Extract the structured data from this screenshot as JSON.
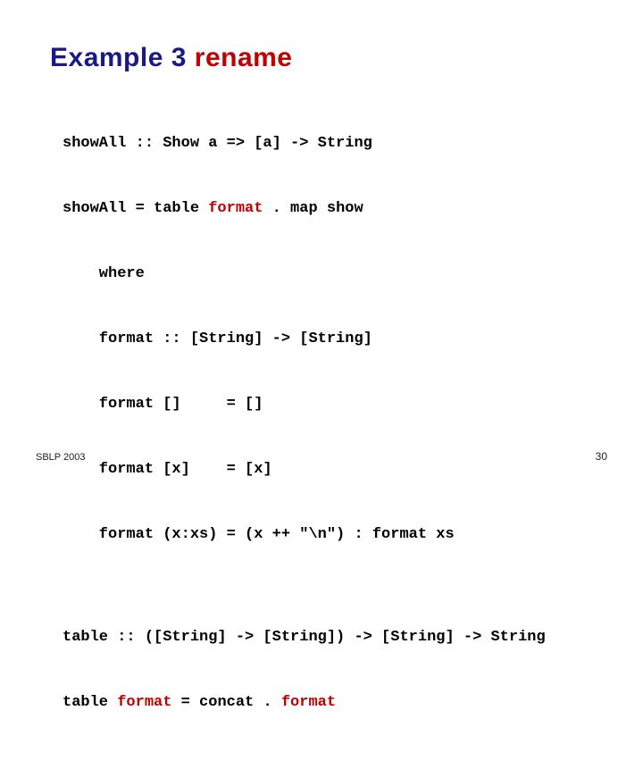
{
  "title": {
    "prefix": "Example 3 ",
    "rename": "rename"
  },
  "code": {
    "l1": "showAll :: Show a => [a] -> String",
    "l2_a": "showAll = table ",
    "l2_b": "format",
    "l2_c": " . map show",
    "l3": "    where",
    "l4": "    format :: [String] -> [String]",
    "l5": "    format []     = []",
    "l6": "    format [x]    = [x]",
    "l7": "    format (x:xs) = (x ++ \"\\n\") : format xs",
    "l8": "table :: ([String] -> [String]) -> [String] -> String",
    "l9_a": "table ",
    "l9_b": "format",
    "l9_c": " = concat . ",
    "l9_d": "format"
  },
  "footer": {
    "left": "SBLP 2003",
    "right": "30"
  }
}
